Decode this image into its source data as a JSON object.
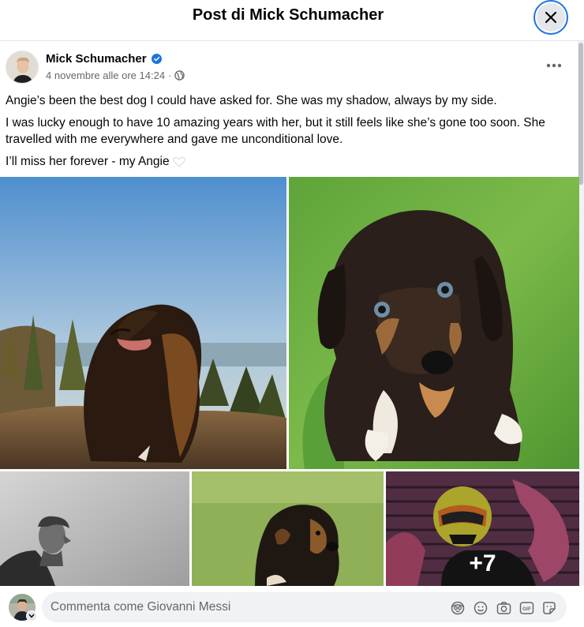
{
  "header": {
    "title": "Post di Mick Schumacher",
    "close_icon": "close-icon"
  },
  "post": {
    "author": "Mick Schumacher",
    "verified": true,
    "timestamp": "4 novembre alle ore 14:24",
    "separator": "·",
    "audience_icon": "globe-icon",
    "more_icon": "more-horizontal-icon",
    "paragraphs": [
      "Angie’s been the best dog I could have asked for. She was my shadow, always by my side.",
      "I was lucky enough to have 10 amazing years with her, but it still feels like she’s gone too soon. She travelled with me everywhere and gave me unconditional love.",
      "I’ll miss her forever - my Angie"
    ],
    "heart_icon": "white-heart-icon",
    "photos": {
      "more_count": "+7"
    }
  },
  "comment": {
    "placeholder": "Commenta come Giovanni Messi",
    "icons": [
      "avatar-sticker-icon",
      "emoji-icon",
      "camera-icon",
      "gif-icon",
      "sticker-icon"
    ]
  },
  "colors": {
    "accent": "#1b74e4",
    "secondary_text": "#65676b",
    "input_bg": "#f0f2f5"
  }
}
